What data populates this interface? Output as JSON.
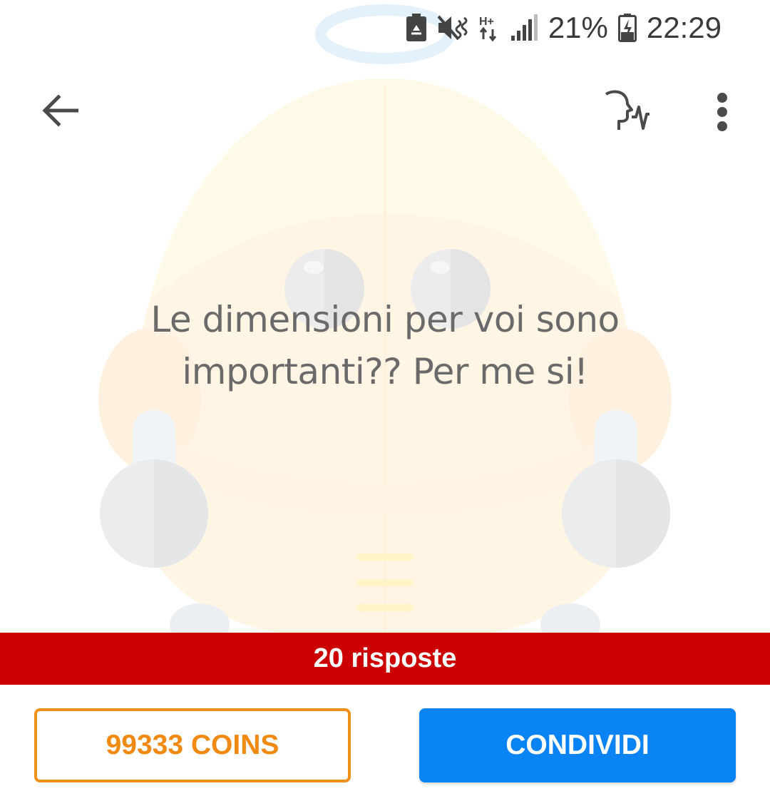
{
  "status_bar": {
    "battery_percent": "21%",
    "time": "22:29",
    "network": "H+",
    "icons": [
      "battery-saver-icon",
      "mute-icon",
      "network-hplus-icon",
      "signal-icon",
      "battery-charging-icon"
    ]
  },
  "toolbar": {
    "back_icon": "back-arrow-icon",
    "voice_icon": "voice-speak-icon",
    "more_icon": "more-vertical-icon"
  },
  "question": {
    "text": "Le dimensioni per voi sono importanti?? Per me si!"
  },
  "answers_bar": {
    "label": "20 risposte",
    "color": "#cc0000"
  },
  "buttons": {
    "coins_label": "99333 COINS",
    "coins_color": "#f08a12",
    "share_label": "CONDIVIDI",
    "share_color": "#0a84f5"
  }
}
